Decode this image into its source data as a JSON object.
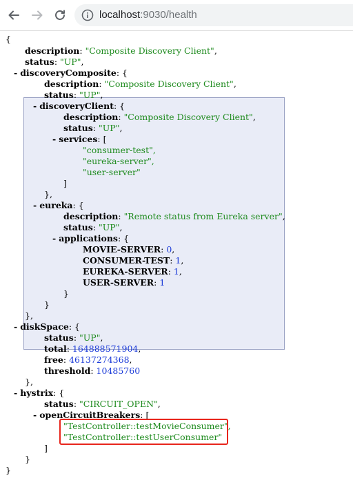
{
  "browser": {
    "url_host": "localhost",
    "url_rest": ":9030/health"
  },
  "json": {
    "description_key": "description",
    "description_val": "\"Composite Discovery Client\"",
    "status_key": "status",
    "status_val": "\"UP\"",
    "discoveryComposite_key": "discoveryComposite",
    "dc_description_val": "\"Composite Discovery Client\"",
    "dc_status_val": "\"UP\"",
    "discoveryClient_key": "discoveryClient",
    "dcl_description_val": "\"Composite Discovery Client\"",
    "dcl_status_val": "\"UP\"",
    "services_key": "services",
    "services": [
      "\"consumer-test\",",
      "\"eureka-server\",",
      "\"user-server\""
    ],
    "eureka_key": "eureka",
    "eureka_description_val": "\"Remote status from Eureka server\"",
    "eureka_status_val": "\"UP\"",
    "applications_key": "applications",
    "applications": [
      {
        "key": "MOVIE-SERVER",
        "val": "0"
      },
      {
        "key": "CONSUMER-TEST",
        "val": "1"
      },
      {
        "key": "EUREKA-SERVER",
        "val": "1"
      },
      {
        "key": "USER-SERVER",
        "val": "1"
      }
    ],
    "diskSpace_key": "diskSpace",
    "disk_status_val": "\"UP\"",
    "total_key": "total",
    "total_val": "164888571904",
    "free_key": "free",
    "free_val": "46137274368",
    "threshold_key": "threshold",
    "threshold_val": "10485760",
    "hystrix_key": "hystrix",
    "hystrix_status_val": "\"CIRCUIT_OPEN\"",
    "openCircuitBreakers_key": "openCircuitBreakers",
    "breakers": [
      "\"TestController::testMovieConsumer\",",
      "\"TestController::testUserConsumer\""
    ]
  },
  "colors": {
    "string": "#1d8a1d",
    "number": "#1a3ad8",
    "highlight_bg": "#e9ecf7",
    "annotation_box": "#e8251c"
  }
}
